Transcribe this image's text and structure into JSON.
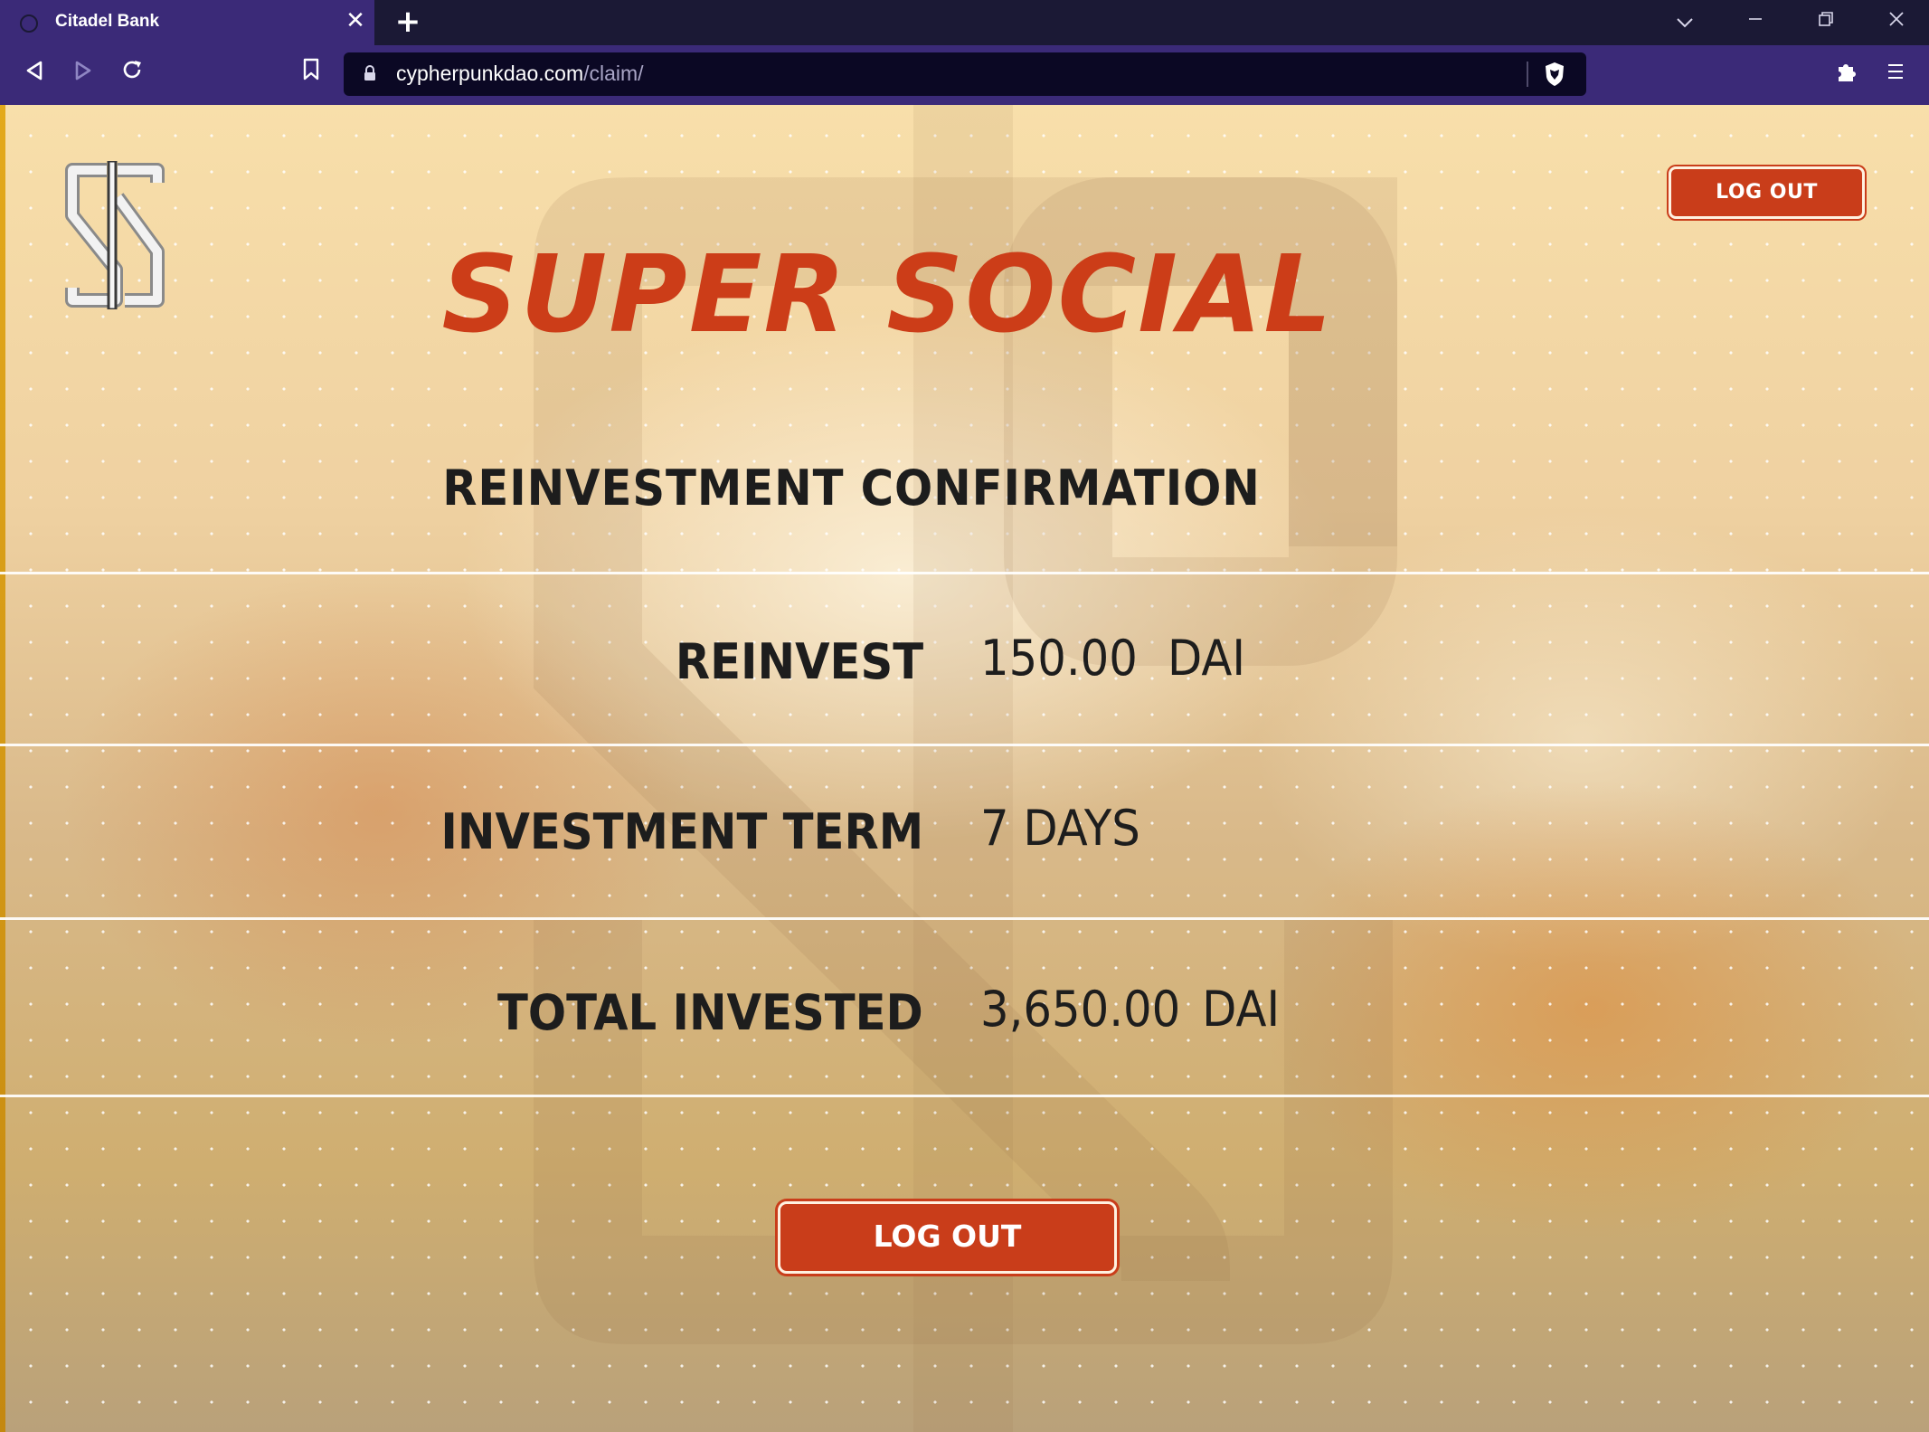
{
  "browser": {
    "tab_title": "Citadel Bank",
    "close_glyph": "✕",
    "new_tab_glyph": "+",
    "url_host": "cypherpunkdao.com",
    "url_path": "/claim/"
  },
  "page": {
    "brand": "SUPER SOCIAL",
    "header_logout": "LOG OUT",
    "section_title": "REINVESTMENT CONFIRMATION",
    "rows": [
      {
        "label": "REINVEST",
        "amount": "150.00",
        "unit": "DAI"
      },
      {
        "label": "INVESTMENT TERM",
        "amount": "7 DAYS",
        "unit": ""
      },
      {
        "label": "TOTAL INVESTED",
        "amount": "3,650.00",
        "unit": "DAI"
      }
    ],
    "footer_logout": "LOG OUT"
  },
  "colors": {
    "accent": "#cc3d18",
    "chrome": "#3b2a78",
    "text": "#1d1d1d"
  }
}
